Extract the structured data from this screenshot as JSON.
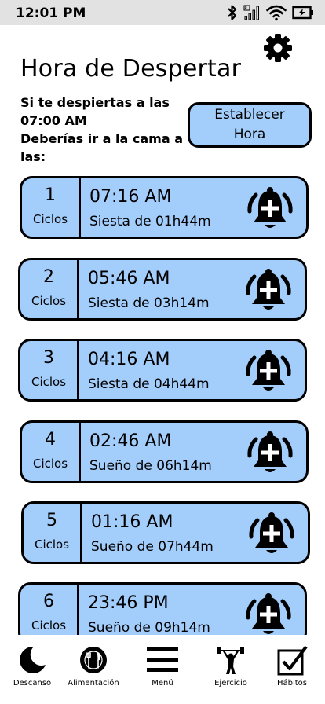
{
  "status": {
    "time": "12:01 PM",
    "icons": [
      "bluetooth-icon",
      "signal-icon",
      "wifi-icon",
      "battery-charging-icon"
    ]
  },
  "header": {
    "title": "Hora de Despertar",
    "settings_icon": "gear-icon"
  },
  "intro": {
    "line1": "Si te despiertas a las",
    "line2": "07:00 AM",
    "line3": "Deberías ir a la cama a",
    "line4": "las:"
  },
  "set_time_button": {
    "line1": "Establecer",
    "line2": "Hora"
  },
  "cycles": [
    {
      "number": "1",
      "label": "Ciclos",
      "time": "07:16 AM",
      "subtitle": "Siesta de 01h44m",
      "icon": "bell-add-icon"
    },
    {
      "number": "2",
      "label": "Ciclos",
      "time": "05:46 AM",
      "subtitle": "Siesta de 03h14m",
      "icon": "bell-add-icon"
    },
    {
      "number": "3",
      "label": "Ciclos",
      "time": "04:16 AM",
      "subtitle": "Siesta de 04h44m",
      "icon": "bell-add-icon"
    },
    {
      "number": "4",
      "label": "Ciclos",
      "time": "02:46 AM",
      "subtitle": "Sueño de 06h14m",
      "icon": "bell-add-icon"
    },
    {
      "number": "5",
      "label": "Ciclos",
      "time": "01:16 AM",
      "subtitle": "Sueño de 07h44m",
      "icon": "bell-add-icon"
    },
    {
      "number": "6",
      "label": "Ciclos",
      "time": "23:46 PM",
      "subtitle": "Sueño de 09h14m",
      "icon": "bell-add-icon"
    }
  ],
  "colors": {
    "card": "#a3cdfb",
    "status_bar": "#e2e2e2",
    "border": "#000000"
  },
  "nav": [
    {
      "label": "Descanso",
      "icon": "moon-icon"
    },
    {
      "label": "Alimentación",
      "icon": "plate-cutlery-icon"
    },
    {
      "label": "Menú",
      "icon": "hamburger-menu-icon"
    },
    {
      "label": "Ejercicio",
      "icon": "weightlifter-icon"
    },
    {
      "label": "Hábitos",
      "icon": "checkbox-icon"
    }
  ]
}
